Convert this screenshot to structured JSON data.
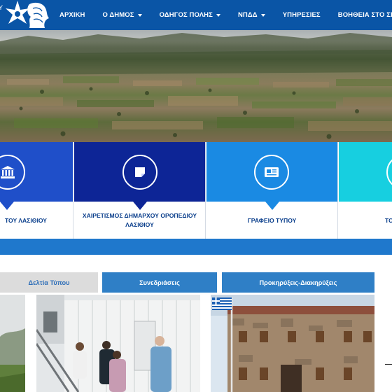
{
  "nav": {
    "items": [
      {
        "label": "ΑΡΧΙΚΗ",
        "has_dropdown": false
      },
      {
        "label": "Ο ΔΗΜΟΣ",
        "has_dropdown": true
      },
      {
        "label": "ΟΔΗΓΟΣ ΠΟΛΗΣ",
        "has_dropdown": true
      },
      {
        "label": "ΝΠΔΔ",
        "has_dropdown": true
      },
      {
        "label": "ΥΠΗΡΕΣΙΕΣ",
        "has_dropdown": false
      },
      {
        "label": "ΒΟΗΘΕΙΑ ΣΤΟ ΣΠΙΤΙ",
        "has_dropdown": false
      }
    ]
  },
  "tiles": [
    {
      "label": "ΤΟΥ ΛΑΣΙΘΙΟΥ",
      "icon": "bank-icon",
      "color": "#1f4fc9"
    },
    {
      "label": "ΧΑΙΡΕΤΙΣΜΟΣ ΔΗΜΑΡΧΟΥ ΟΡΟΠΕΔΙΟΥ ΛΑΣΙΘΙΟΥ",
      "icon": "note-icon",
      "color": "#0d2596"
    },
    {
      "label": "ΓΡΑΦΕΙΟ ΤΥΠΟΥ",
      "icon": "newspaper-icon",
      "color": "#1a8ae3"
    },
    {
      "label": "ΤΟ",
      "icon": "circle-icon",
      "color": "#17cfe0"
    }
  ],
  "tabs": [
    {
      "label": "Δελτία Τύπου",
      "active": true
    },
    {
      "label": "Συνεδριάσεις",
      "active": false
    },
    {
      "label": "Προκηρύξεις-Διακηρύξεις",
      "active": false
    }
  ],
  "colors": {
    "header": "#0a55a6",
    "band": "#1f78cc",
    "tab_active_bg": "#dcdcdc",
    "tab_bg": "#2f7fc6",
    "tile_label_text": "#0b3f8c"
  }
}
